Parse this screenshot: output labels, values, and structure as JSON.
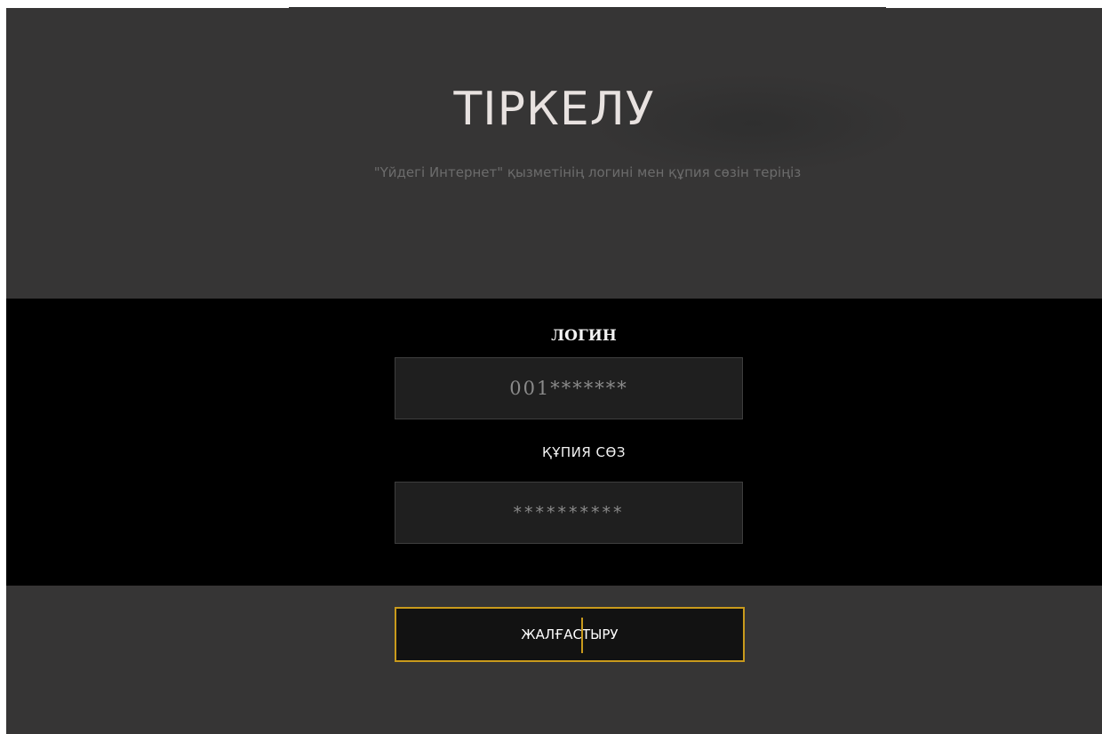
{
  "header": {
    "title": "ТІРКЕЛУ",
    "subtitle": "\"Үйдегі Интернет\" қызметінің логині мен құпия сөзін теріңіз"
  },
  "form": {
    "login_label": "ЛОГИН",
    "login_value": "001*******",
    "password_label": "ҚҰПИЯ СӨЗ",
    "password_value": "**********"
  },
  "actions": {
    "submit_label": "ЖАЛҒАСТЫРУ"
  },
  "colors": {
    "background": "#363535",
    "form_band": "#000000",
    "input_bg": "#1f1f1f",
    "accent": "#c99a1c",
    "title_text": "#e8e2e0",
    "subtitle_text": "#6c6c6c"
  }
}
